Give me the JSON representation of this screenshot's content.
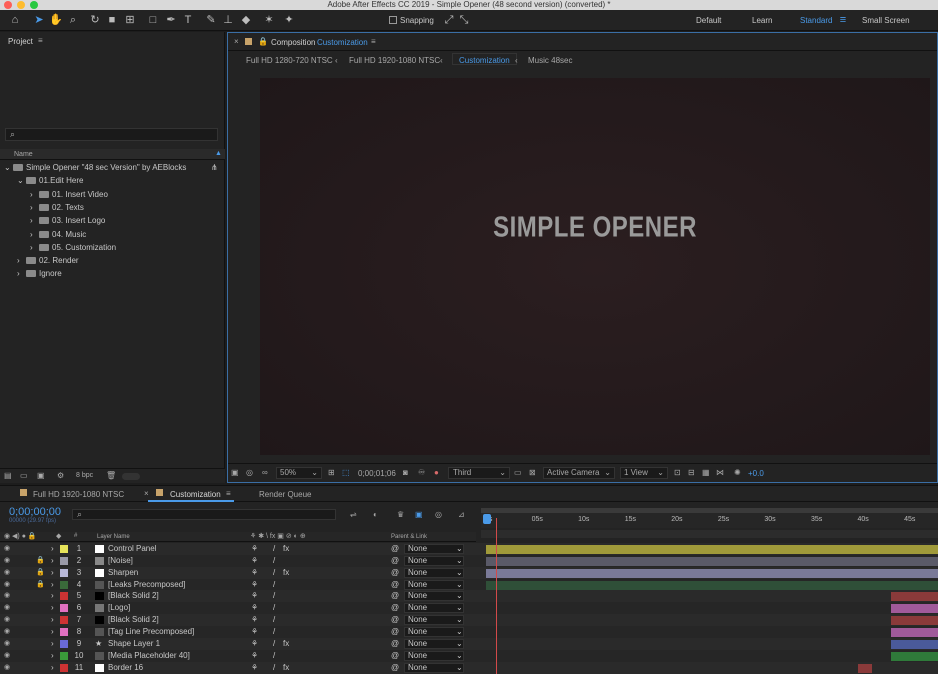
{
  "window_title": "Adobe After Effects CC 2019 - Simple Opener (48 second version) (converted) *",
  "toolbar": {
    "snapping": "Snapping",
    "workspaces": [
      "Default",
      "Learn",
      "Standard",
      "Small Screen"
    ],
    "active_workspace": "Standard"
  },
  "project": {
    "title": "Project",
    "col_name": "Name",
    "tree": [
      {
        "label": "Simple Opener \"48 sec Version\" by AEBlocks",
        "level": 0,
        "open": true
      },
      {
        "label": "01.Edit Here",
        "level": 1,
        "open": true
      },
      {
        "label": "01. Insert Video",
        "level": 2
      },
      {
        "label": "02. Texts",
        "level": 2
      },
      {
        "label": "03. Insert Logo",
        "level": 2
      },
      {
        "label": "04. Music",
        "level": 2
      },
      {
        "label": "05. Customization",
        "level": 2
      },
      {
        "label": "02. Render",
        "level": 1
      },
      {
        "label": "Ignore",
        "level": 1
      }
    ],
    "bpc": "8 bpc"
  },
  "composition": {
    "panel_label": "Composition",
    "panel_name": "Customization",
    "crumbs": [
      "Full HD 1280-720 NTSC",
      "Full HD 1920-1080 NTSC",
      "Customization",
      "Music 48sec"
    ],
    "active_crumb": "Customization",
    "viewer_text": "SIMPLE OPENER",
    "zoom": "50%",
    "timecode": "0;00;01;06",
    "resolution": "Third",
    "camera": "Active Camera",
    "views": "1 View",
    "exposure": "+0.0"
  },
  "timeline": {
    "tabs": [
      "Full HD 1920-1080 NTSC",
      "Customization",
      "Render Queue"
    ],
    "active_tab": "Customization",
    "timecode": "0;00;00;00",
    "fps": "00000 (29.97 fps)",
    "col_layer": "Layer Name",
    "col_parent": "Parent & Link",
    "ruler": [
      "0s",
      "05s",
      "10s",
      "15s",
      "20s",
      "25s",
      "30s",
      "35s",
      "40s",
      "45s"
    ],
    "layers": [
      {
        "num": "1",
        "name": "Control Panel",
        "label": "#e6e35a",
        "thumb": "#ffffff",
        "parent": "None",
        "bar": "#a09a3a",
        "bar_start": 0,
        "bar_end": 48,
        "fx": true,
        "lock": false
      },
      {
        "num": "2",
        "name": "[Noise]",
        "label": "#9a9aa8",
        "thumb": "#888888",
        "parent": "None",
        "bar": "#5a5a68",
        "bar_start": 0,
        "bar_end": 48,
        "fx": false,
        "lock": true
      },
      {
        "num": "3",
        "name": "Sharpen",
        "label": "#b8b8d8",
        "thumb": "#ffffff",
        "parent": "None",
        "bar": "#7a7a98",
        "bar_start": 0,
        "bar_end": 48,
        "fx": true,
        "lock": true
      },
      {
        "num": "4",
        "name": "[Leaks Precomposed]",
        "label": "#3a6a3a",
        "thumb": "#555555",
        "parent": "None",
        "bar": "#2f4f38",
        "bar_start": 0,
        "bar_end": 48,
        "fx": false,
        "lock": true
      },
      {
        "num": "5",
        "name": "[Black Solid 2]",
        "label": "#cc3333",
        "thumb": "#000000",
        "parent": "None",
        "bar": "#8a3a3a",
        "bar_start": 43,
        "bar_end": 48,
        "fx": false,
        "lock": false
      },
      {
        "num": "6",
        "name": "[Logo]",
        "label": "#e070c0",
        "thumb": "#777777",
        "parent": "None",
        "bar": "#a05a9a",
        "bar_start": 43,
        "bar_end": 48,
        "fx": false,
        "lock": false
      },
      {
        "num": "7",
        "name": "[Black Solid 2]",
        "label": "#cc3333",
        "thumb": "#000000",
        "parent": "None",
        "bar": "#8a3a3a",
        "bar_start": 43,
        "bar_end": 48,
        "fx": false,
        "lock": false
      },
      {
        "num": "8",
        "name": "[Tag Line Precomposed]",
        "label": "#e070c0",
        "thumb": "#555555",
        "parent": "None",
        "bar": "#a05a9a",
        "bar_start": 43,
        "bar_end": 48,
        "fx": false,
        "lock": false
      },
      {
        "num": "9",
        "name": "Shape Layer 1",
        "label": "#6a6ad8",
        "thumb": "",
        "parent": "None",
        "bar": "#4a5a9a",
        "bar_start": 43,
        "bar_end": 48,
        "fx": true,
        "lock": false
      },
      {
        "num": "10",
        "name": "[Media Placeholder 40]",
        "label": "#3a9a3a",
        "thumb": "#555555",
        "parent": "None",
        "bar": "#2f7a3a",
        "bar_start": 43,
        "bar_end": 48,
        "fx": false,
        "lock": false
      },
      {
        "num": "11",
        "name": "Border 16",
        "label": "#cc3333",
        "thumb": "#ffffff",
        "parent": "None",
        "bar": "#8a3a3a",
        "bar_start": 39.5,
        "bar_end": 41,
        "fx": true,
        "lock": false
      }
    ]
  }
}
